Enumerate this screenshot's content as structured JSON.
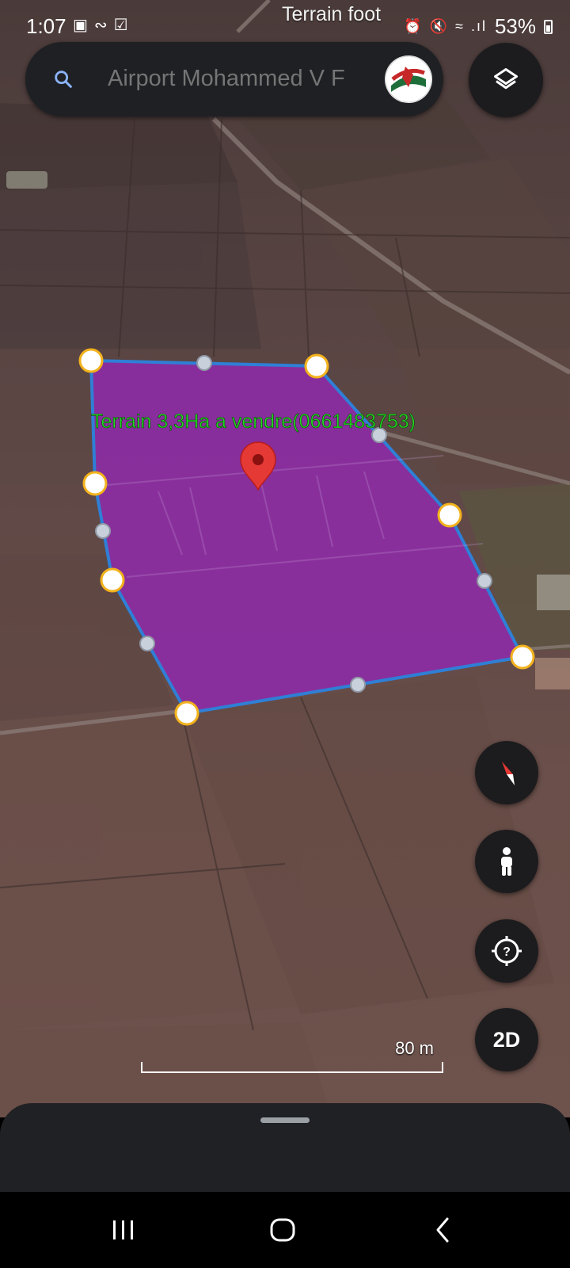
{
  "status_bar": {
    "time": "1:07",
    "battery": "53%",
    "project_title": "Terrain foot"
  },
  "search": {
    "placeholder": "Airport Mohammed V F"
  },
  "map": {
    "placemark_label": "Terrain 3,3Ha a vendre(0661483753)",
    "polygon_fill": "#8e2ba8",
    "polygon_stroke": "#2f7fd6",
    "label_color": "#22dd22",
    "scale_label": "80 m"
  },
  "controls": {
    "view_mode_label": "2D"
  },
  "icons": {
    "search": "search-icon",
    "layers": "layers-icon",
    "compass": "compass-icon",
    "pegman": "pegman-icon",
    "locate": "locate-icon",
    "recents": "recents-icon",
    "home": "home-icon",
    "back": "back-icon"
  }
}
